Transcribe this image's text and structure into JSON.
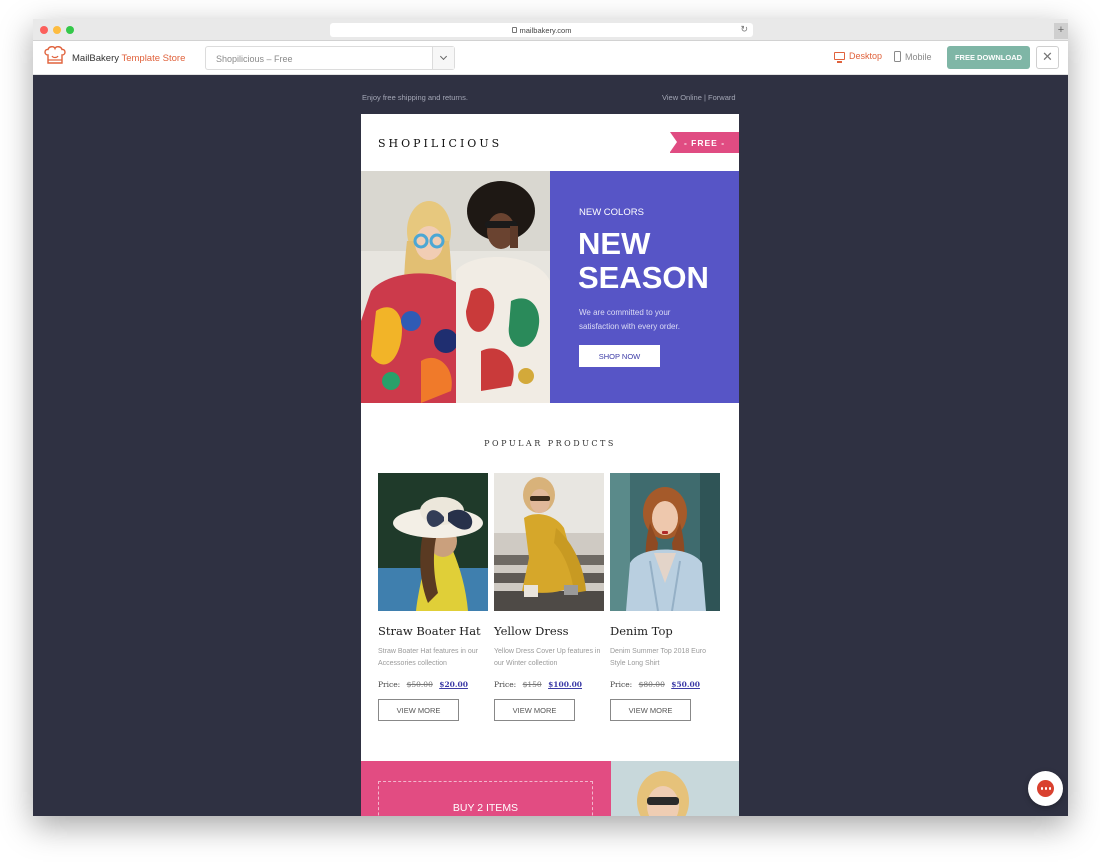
{
  "browser": {
    "url": "mailbakery.com"
  },
  "app": {
    "brand_name": "MailBakery",
    "brand_suffix": "Template Store",
    "template_select": "Shopilicious – Free",
    "desktop_label": "Desktop",
    "mobile_label": "Mobile",
    "download_label": "FREE DOWNLOAD",
    "close_label": "✕",
    "accent_color": "#e0623c",
    "download_color": "#7fb6a6"
  },
  "preheader": {
    "left": "Enjoy free shipping and returns.",
    "view_online": "View Online",
    "separator": "|",
    "forward": "Forward"
  },
  "email": {
    "logo": "SHOPILICIOUS",
    "badge": "- FREE -",
    "hero": {
      "kicker": "NEW COLORS",
      "title": "NEW SEASON",
      "text": "We are committed to your satisfaction with every order.",
      "button": "SHOP NOW",
      "panel_color": "#5755c6"
    },
    "section_title": "POPULAR PRODUCTS",
    "products": [
      {
        "name": "Straw Boater Hat",
        "desc": "Straw Boater Hat features in our Accessories collection",
        "price_label": "Price:",
        "old_price": "$50.00",
        "new_price": "$20.00",
        "button": "VIEW MORE"
      },
      {
        "name": "Yellow Dress",
        "desc": "Yellow Dress Cover Up features in our Winter collection",
        "price_label": "Price:",
        "old_price": "$150",
        "new_price": "$100.00",
        "button": "VIEW MORE"
      },
      {
        "name": "Denim Top",
        "desc": "Denim Summer Top 2018 Euro Style Long Shirt",
        "price_label": "Price:",
        "old_price": "$80.00",
        "new_price": "$50.00",
        "button": "VIEW MORE"
      }
    ],
    "promo": {
      "text": "BUY 2 ITEMS",
      "color": "#e24c82"
    }
  },
  "chat": {
    "icon": "chat-bubble-icon",
    "color": "#d9412f"
  }
}
